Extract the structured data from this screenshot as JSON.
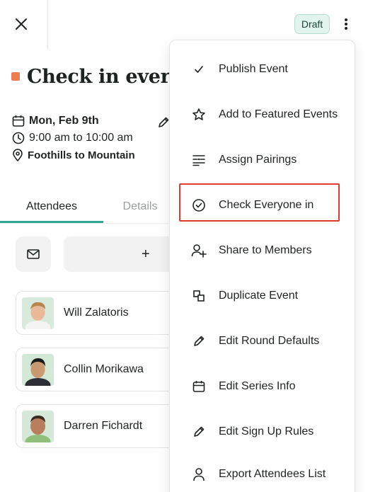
{
  "header": {
    "status_badge": "Draft"
  },
  "event": {
    "title": "Check in everyo",
    "date": "Mon, Feb 9th",
    "time": "9:00 am to 10:00 am",
    "location": "Foothills to Mountain",
    "accent_color": "#ef7b50"
  },
  "tabs": [
    {
      "label": "Attendees",
      "active": true
    },
    {
      "label": "Details",
      "active": false
    }
  ],
  "actions": {
    "add_symbol": "+"
  },
  "attendees": [
    {
      "name": "Will Zalatoris"
    },
    {
      "name": "Collin Morikawa"
    },
    {
      "name": "Darren Fichardt"
    }
  ],
  "menu": {
    "items": [
      {
        "label": "Publish Event",
        "icon": "check-icon"
      },
      {
        "label": "Add to Featured Events",
        "icon": "star-icon"
      },
      {
        "label": "Assign Pairings",
        "icon": "pairings-icon"
      },
      {
        "label": "Check Everyone in",
        "icon": "check-circle-icon",
        "highlighted": true
      },
      {
        "label": "Share to Members",
        "icon": "user-plus-icon"
      },
      {
        "label": "Duplicate Event",
        "icon": "duplicate-icon"
      },
      {
        "label": "Edit Round Defaults",
        "icon": "pencil-icon"
      },
      {
        "label": "Edit Series Info",
        "icon": "calendar-icon"
      },
      {
        "label": "Edit Sign Up Rules",
        "icon": "pencil-icon"
      },
      {
        "label": "Export Attendees List",
        "icon": "user-icon"
      }
    ]
  },
  "colors": {
    "tab_indicator": "#2ea691",
    "highlight_border": "#e03b33",
    "badge_background": "#e1f4ee"
  }
}
